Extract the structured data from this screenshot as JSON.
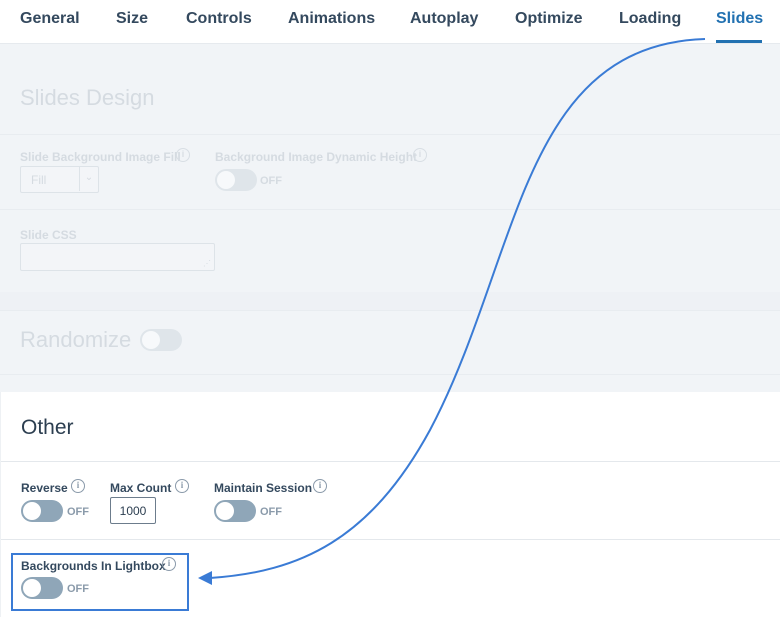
{
  "tabs": [
    {
      "label": "General",
      "active": false
    },
    {
      "label": "Size",
      "active": false
    },
    {
      "label": "Controls",
      "active": false
    },
    {
      "label": "Animations",
      "active": false
    },
    {
      "label": "Autoplay",
      "active": false
    },
    {
      "label": "Optimize",
      "active": false
    },
    {
      "label": "Loading",
      "active": false
    },
    {
      "label": "Slides",
      "active": true
    }
  ],
  "slides_design": {
    "title": "Slides Design",
    "bg_fill": {
      "label": "Slide Background Image Fill",
      "value": "Fill"
    },
    "dynamic_height": {
      "label": "Background Image Dynamic Height",
      "state": "OFF"
    },
    "slide_css": {
      "label": "Slide CSS",
      "value": ""
    },
    "randomize": {
      "label": "Randomize",
      "state": "off"
    }
  },
  "other": {
    "title": "Other",
    "reverse": {
      "label": "Reverse",
      "state": "OFF"
    },
    "max_count": {
      "label": "Max Count",
      "value": "1000"
    },
    "maintain_session": {
      "label": "Maintain Session",
      "state": "OFF"
    },
    "backgrounds_lightbox": {
      "label": "Backgrounds In Lightbox",
      "state": "OFF"
    }
  },
  "icons": {
    "info": "i",
    "select_arrow": "⌄",
    "resize_grip": "⋰"
  },
  "colors": {
    "accent": "#2271b1",
    "arrow": "#3a7bd5",
    "toggle_off": "#8fa6b8",
    "text": "#34495e"
  }
}
